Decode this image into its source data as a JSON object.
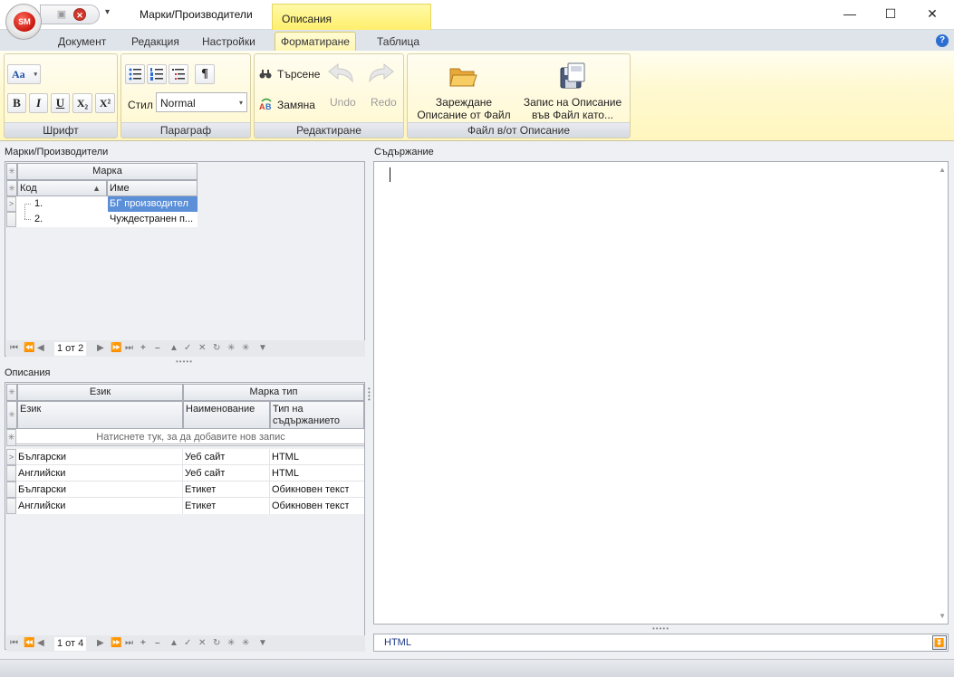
{
  "window": {
    "title": "Марки/Производители",
    "context_tab": "Описания",
    "minimize": "—",
    "maximize": "☐",
    "close": "✕",
    "orb_text": "SM",
    "qat_arrow": "▾"
  },
  "tabs": [
    "Документ",
    "Редакция",
    "Настройки",
    "Форматиране",
    "Таблица"
  ],
  "active_tab": "Форматиране",
  "help": "?",
  "ribbon": {
    "font_group": {
      "label": "Шрифт",
      "aa": "Aa",
      "bold": "B",
      "italic": "I",
      "underline": "U",
      "subscript": "X₂",
      "superscript": "X²"
    },
    "paragraph_group": {
      "label": "Параграф",
      "style_label": "Стил",
      "style_value": "Normal",
      "pilcrow": "¶"
    },
    "edit_group": {
      "label": "Редактиране",
      "search": "Търсене",
      "replace": "Замяна",
      "undo": "Undo",
      "redo": "Redo"
    },
    "file_group": {
      "label": "Файл в/от Описание",
      "load_line1": "Зареждане",
      "load_line2": "Описание от Файл",
      "save_line1": "Запис на Описание",
      "save_line2": "във Файл като..."
    }
  },
  "brands": {
    "caption": "Марки/Производители",
    "band": "Марка",
    "columns": [
      "Код",
      "Име"
    ],
    "rows": [
      {
        "code": "1.",
        "name": "БГ производител"
      },
      {
        "code": "2.",
        "name": "Чуждестранен п..."
      }
    ],
    "nav_position": "1 от 2"
  },
  "descriptions": {
    "caption": "Описания",
    "band_left": "Език",
    "band_right": "Марка тип",
    "columns": [
      "Език",
      "Наименование",
      "Тип на съдържанието"
    ],
    "new_row_hint": "Натиснете тук, за да добавите нов запис",
    "rows": [
      {
        "lang": "Български",
        "name": "Уеб сайт",
        "type": "HTML"
      },
      {
        "lang": "Английски",
        "name": "Уеб сайт",
        "type": "HTML"
      },
      {
        "lang": "Български",
        "name": "Етикет",
        "type": "Обикновен текст"
      },
      {
        "lang": "Английски",
        "name": "Етикет",
        "type": "Обикновен текст"
      }
    ],
    "nav_position": "1 от 4"
  },
  "content": {
    "caption": "Съдържание",
    "format_value": "HTML"
  }
}
